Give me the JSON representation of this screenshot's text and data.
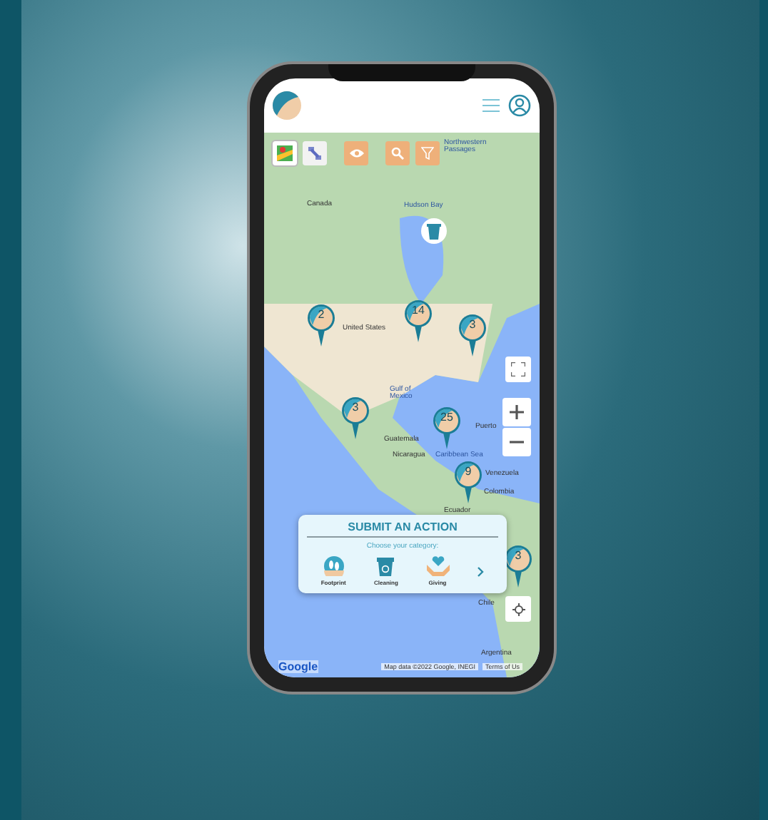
{
  "map": {
    "labels": [
      "Northwestern Passages",
      "Canada",
      "Hudson Bay",
      "United States",
      "Gulf of Mexico",
      "Guatemala",
      "Nicaragua",
      "Caribbean Sea",
      "Puerto",
      "Venezuela",
      "Colombia",
      "Ecuador",
      "Chile",
      "Argentina"
    ],
    "clusters": [
      {
        "count": "2"
      },
      {
        "count": "14"
      },
      {
        "count": "3"
      },
      {
        "count": "3"
      },
      {
        "count": "25"
      },
      {
        "count": "9"
      },
      {
        "count": "3"
      }
    ],
    "attribution": "Map data ©2022 Google, INEGI",
    "terms": "Terms of Us",
    "logo": "Google"
  },
  "toolbar": [
    {
      "kind": "map",
      "selected": true
    },
    {
      "kind": "satellite",
      "selected": false
    },
    {
      "kind": "eye"
    },
    {
      "kind": "search"
    },
    {
      "kind": "filter"
    }
  ],
  "action_card": {
    "title": "SUBMIT AN ACTION",
    "subtitle": "Choose your category:",
    "categories": [
      {
        "kind": "footprint",
        "label": "Footprint"
      },
      {
        "kind": "cleaning",
        "label": "Cleaning"
      },
      {
        "kind": "giving",
        "label": "Giving"
      }
    ]
  }
}
